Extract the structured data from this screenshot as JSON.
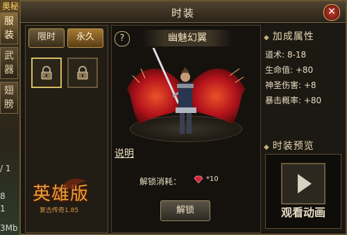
{
  "left_edge": {
    "corner_tag": "奥秘",
    "tabs": [
      {
        "label": "服装",
        "active": true
      },
      {
        "label": "武器",
        "active": false
      },
      {
        "label": "翅膀",
        "active": false
      }
    ],
    "stats": [
      "/ 1",
      "8",
      "1",
      "3Mb"
    ]
  },
  "window": {
    "title": "时装",
    "close_icon": "close-icon"
  },
  "left_panel": {
    "tab_limited": "限时",
    "tab_permanent": "永久",
    "slots": [
      {
        "icon": "lock-icon",
        "selected": true
      },
      {
        "icon": "lock-icon",
        "selected": false
      }
    ],
    "logo_main": "英雄版",
    "logo_sub": "复古传奇1.85"
  },
  "center": {
    "help_label": "?",
    "item_name": "幽魅幻翼",
    "desc_link": "说明",
    "cost_label": "解锁消耗：",
    "cost_icon": "gem-icon",
    "cost_value": "*10",
    "unlock_button": "解锁"
  },
  "right": {
    "bonus_title": "加成属性",
    "stats": [
      "道术: 8-18",
      "生命值: +80",
      "神圣伤害: +8",
      "暴击概率: +80"
    ],
    "preview_title": "时装预览",
    "watch_label": "观看动画"
  },
  "colors": {
    "accent": "#d8bf62",
    "wing_red": "#c8141e",
    "frame": "#6a5533"
  }
}
